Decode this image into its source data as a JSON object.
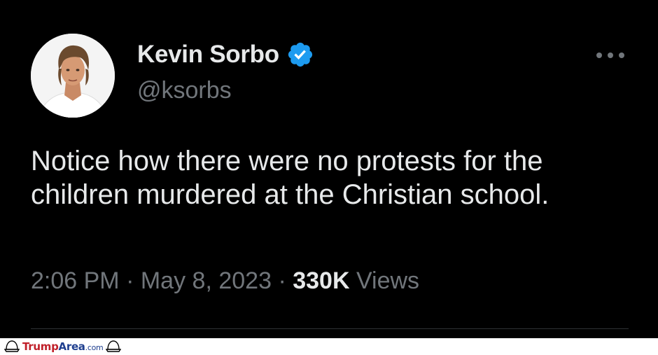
{
  "tweet": {
    "display_name": "Kevin Sorbo",
    "handle": "@ksorbs",
    "text": "Notice how there were no protests for the children murdered at the Christian school.",
    "time": "2:06 PM",
    "separator": "·",
    "date": "May 8, 2023",
    "views_count": "330K",
    "views_label": "Views",
    "verified_color": "#1d9bf0"
  },
  "icons": {
    "verified": "verified-badge-icon",
    "more": "more-options-icon",
    "watermark": "hat-icon"
  },
  "watermark": {
    "brand_part1": "Trump",
    "brand_part2": "Area",
    "brand_suffix": ".com",
    "colors": {
      "trump": "#c0202a",
      "area": "#1f3f8f"
    }
  }
}
